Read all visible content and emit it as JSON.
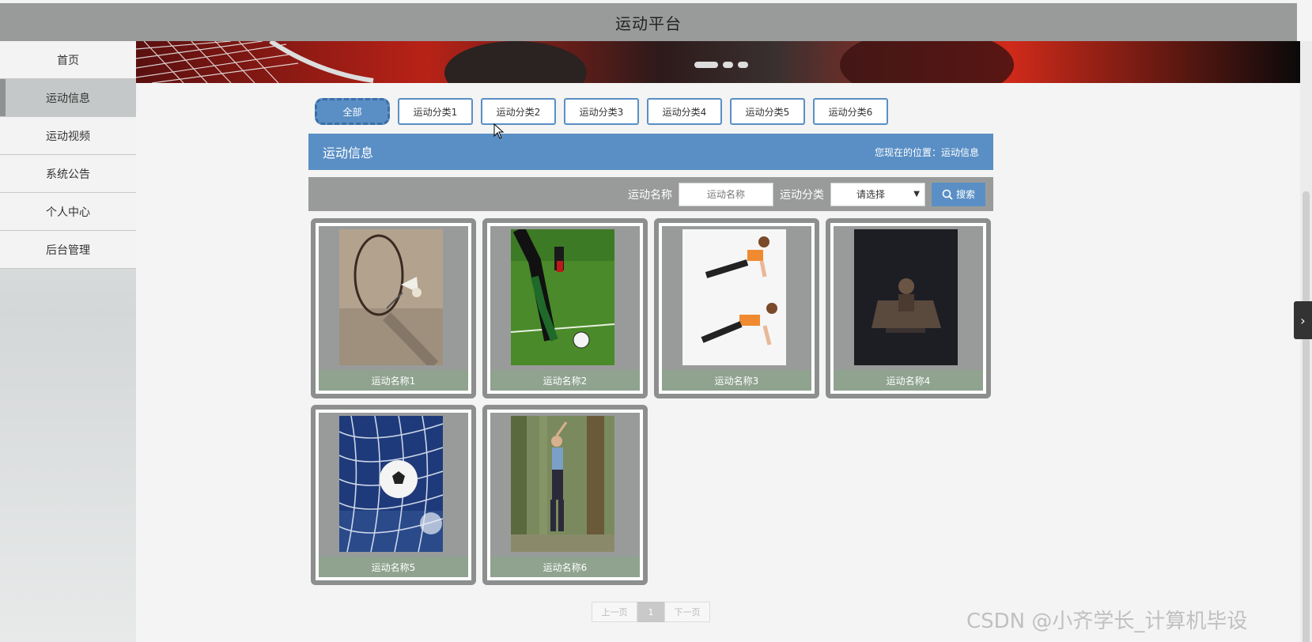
{
  "header": {
    "title": "运动平台"
  },
  "sidebar": {
    "items": [
      {
        "label": "首页",
        "active": false
      },
      {
        "label": "运动信息",
        "active": true
      },
      {
        "label": "运动视频",
        "active": false
      },
      {
        "label": "系统公告",
        "active": false
      },
      {
        "label": "个人中心",
        "active": false
      },
      {
        "label": "后台管理",
        "active": false
      }
    ]
  },
  "categories": [
    {
      "label": "全部",
      "active": true
    },
    {
      "label": "运动分类1",
      "active": false
    },
    {
      "label": "运动分类2",
      "active": false
    },
    {
      "label": "运动分类3",
      "active": false
    },
    {
      "label": "运动分类4",
      "active": false
    },
    {
      "label": "运动分类5",
      "active": false
    },
    {
      "label": "运动分类6",
      "active": false
    }
  ],
  "title_bar": {
    "title": "运动信息",
    "breadcrumb": "您现在的位置：运动信息"
  },
  "search": {
    "name_label": "运动名称",
    "name_placeholder": "运动名称",
    "category_label": "运动分类",
    "category_selected": "请选择",
    "button_label": "搜索"
  },
  "cards": [
    {
      "caption": "运动名称1",
      "image": "badminton"
    },
    {
      "caption": "运动名称2",
      "image": "football-kick"
    },
    {
      "caption": "运动名称3",
      "image": "plank"
    },
    {
      "caption": "运动名称4",
      "image": "dark-gym"
    },
    {
      "caption": "运动名称5",
      "image": "soccer-net"
    },
    {
      "caption": "运动名称6",
      "image": "forest-stretch"
    }
  ],
  "pager": {
    "prev": "上一页",
    "current": "1",
    "next": "下一页"
  },
  "watermark": "CSDN @小齐学长_计算机毕设",
  "colors": {
    "header_bg": "#999b9b",
    "accent": "#5a8fc5",
    "caption_bg": "#8fa38f",
    "card_border": "#8d8f8f"
  }
}
